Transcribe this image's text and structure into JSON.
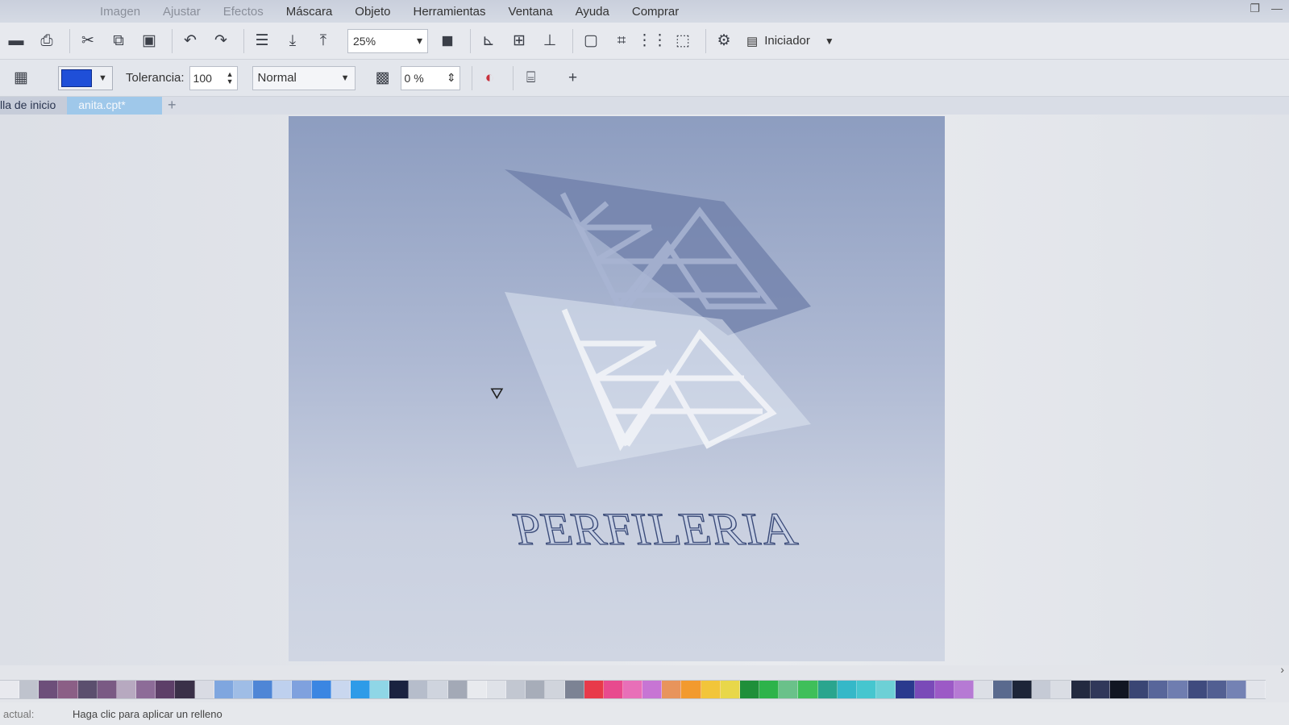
{
  "menubar": {
    "items": [
      {
        "label": "Imagen",
        "faded": true
      },
      {
        "label": "Ajustar",
        "faded": true
      },
      {
        "label": "Efectos",
        "faded": true
      },
      {
        "label": "Máscara",
        "faded": false
      },
      {
        "label": "Objeto",
        "faded": false
      },
      {
        "label": "Herramientas",
        "faded": false
      },
      {
        "label": "Ventana",
        "faded": false
      },
      {
        "label": "Ayuda",
        "faded": false
      },
      {
        "label": "Comprar",
        "faded": false
      }
    ]
  },
  "toolbar": {
    "zoom_value": "25%",
    "launcher_label": "Iniciador"
  },
  "property_bar": {
    "fill_color": "#1f4fd8",
    "tolerance_label": "Tolerancia:",
    "tolerance_value": "100",
    "merge_mode": "Normal",
    "transparency_value": "0 %"
  },
  "tabs": {
    "home_label": "lla de inicio",
    "active_label": "anita.cpt*"
  },
  "canvas": {
    "logo_text": "PERFILERIA"
  },
  "palette": {
    "colors": [
      "#e8e9ee",
      "#bfc3cd",
      "#6d4f7a",
      "#8b5f86",
      "#5b4f6e",
      "#7a5a84",
      "#b7a9c0",
      "#8d6c98",
      "#5d3f68",
      "#3a3048",
      "#d9dbe3",
      "#7fa6df",
      "#9fbde6",
      "#4f86d6",
      "#bed0ee",
      "#7fa1de",
      "#3b86e2",
      "#c9d7ef",
      "#2e9be8",
      "#8fd6e6",
      "#1a2240",
      "#b6bdcb",
      "#cfd4de",
      "#a3a9b6",
      "#e8eaee",
      "#dfe2e8",
      "#c2c7d1",
      "#a7adb9",
      "#d0d4dc",
      "#7c8394",
      "#e83a4a",
      "#e84a8e",
      "#e86fb8",
      "#c775d4",
      "#e8945c",
      "#f29a2e",
      "#f2c53a",
      "#e8d74a",
      "#1f8f3a",
      "#2db34a",
      "#6ac18a",
      "#3fbf5a",
      "#2aa58e",
      "#35b8c8",
      "#46c6cf",
      "#6dd0d6",
      "#2a3a8e",
      "#7a4ab8",
      "#9c5ac6",
      "#b67ad4",
      "#dcdfe6",
      "#5a6a8e",
      "#1d2538",
      "#c5cad5",
      "#dadde4",
      "#232a40",
      "#30385a",
      "#111622",
      "#3a4674",
      "#58669a",
      "#6f7db0",
      "#3f4b7e",
      "#525f92",
      "#7482b4",
      "#e2e4ea"
    ]
  },
  "statusbar": {
    "label": "actual:",
    "hint": "Haga clic para aplicar un relleno"
  }
}
